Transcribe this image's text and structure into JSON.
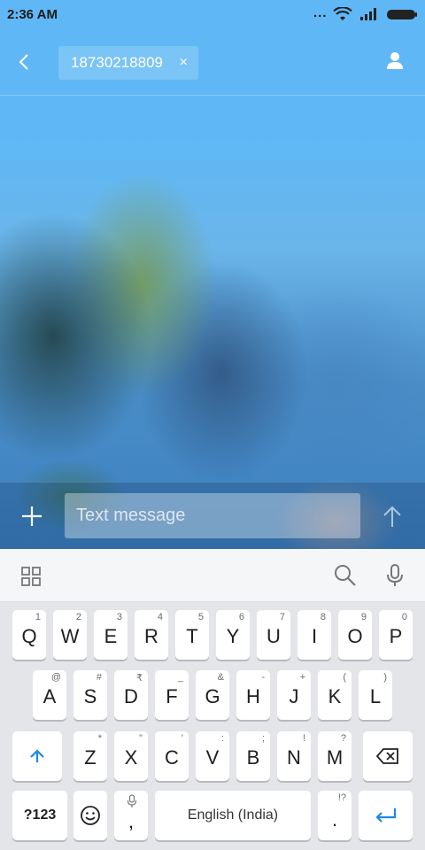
{
  "status_bar": {
    "time": "2:36 AM",
    "dots": "..."
  },
  "header": {
    "recipient": "18730218809",
    "chip_close": "×"
  },
  "compose": {
    "placeholder": "Text message"
  },
  "keyboard": {
    "row1": [
      {
        "key": "Q",
        "hint": "1"
      },
      {
        "key": "W",
        "hint": "2"
      },
      {
        "key": "E",
        "hint": "3"
      },
      {
        "key": "R",
        "hint": "4"
      },
      {
        "key": "T",
        "hint": "5"
      },
      {
        "key": "Y",
        "hint": "6"
      },
      {
        "key": "U",
        "hint": "7"
      },
      {
        "key": "I",
        "hint": "8"
      },
      {
        "key": "O",
        "hint": "9"
      },
      {
        "key": "P",
        "hint": "0"
      }
    ],
    "row2": [
      {
        "key": "A",
        "hint": "@"
      },
      {
        "key": "S",
        "hint": "#"
      },
      {
        "key": "D",
        "hint": "₹"
      },
      {
        "key": "F",
        "hint": "_"
      },
      {
        "key": "G",
        "hint": "&"
      },
      {
        "key": "H",
        "hint": "-"
      },
      {
        "key": "J",
        "hint": "+"
      },
      {
        "key": "K",
        "hint": "("
      },
      {
        "key": "L",
        "hint": ")"
      }
    ],
    "row3": [
      {
        "key": "Z",
        "hint": "*"
      },
      {
        "key": "X",
        "hint": "\""
      },
      {
        "key": "C",
        "hint": "'"
      },
      {
        "key": "V",
        "hint": ":"
      },
      {
        "key": "B",
        "hint": ";"
      },
      {
        "key": "N",
        "hint": "!"
      },
      {
        "key": "M",
        "hint": "?"
      }
    ],
    "symbols_label": "?123",
    "comma": ",",
    "space_label": "English (India)",
    "period": ".",
    "period_hint": "!?"
  },
  "colors": {
    "header_bg": "#5fb8f5",
    "accent_blue": "#1e88e5",
    "keyboard_bg": "#e4e5e8"
  }
}
